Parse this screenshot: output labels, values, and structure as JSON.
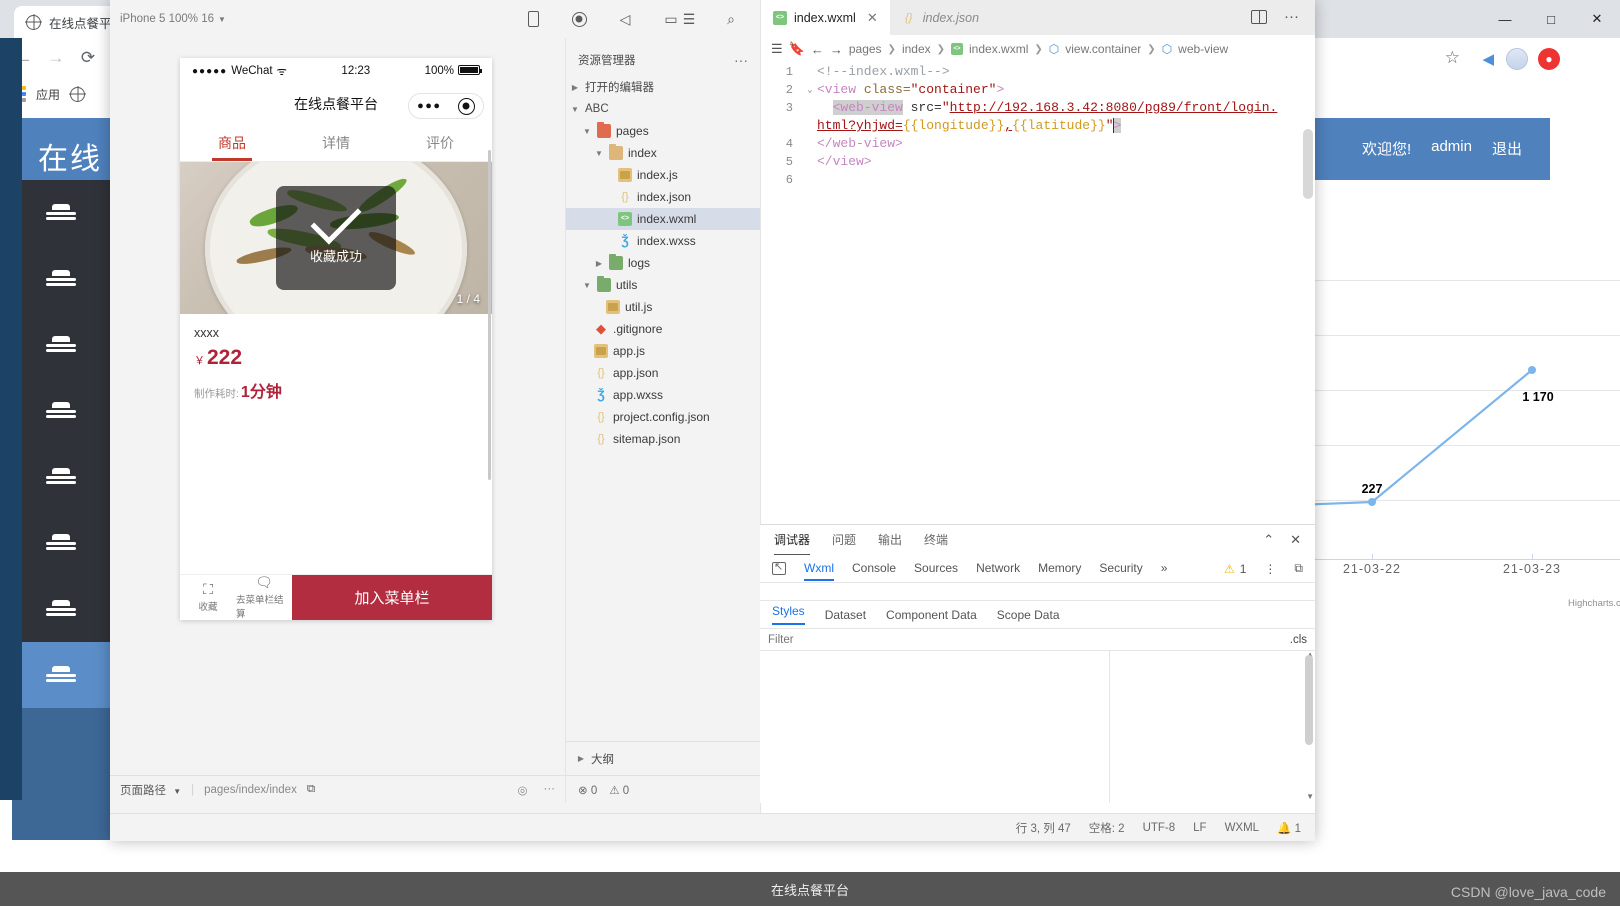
{
  "browser": {
    "tab_title": "在线点餐平",
    "bookmark_apps": "应用",
    "window_buttons": {
      "minimize": "—",
      "maximize": "□",
      "close": "✕"
    }
  },
  "webapp": {
    "title": "在线",
    "welcome": "欢迎您!",
    "username": "admin",
    "logout": "退出",
    "accent": "#4f81bd",
    "sidebar_dark": "#2f3238",
    "sidebar_items": [
      {
        "name": "menu-icon"
      },
      {
        "name": "menu-icon"
      },
      {
        "name": "menu-icon"
      },
      {
        "name": "menu-icon"
      },
      {
        "name": "menu-icon"
      },
      {
        "name": "menu-icon"
      },
      {
        "name": "menu-icon"
      },
      {
        "name": "menu-icon"
      }
    ]
  },
  "chart_data": {
    "type": "line",
    "title": "",
    "subtitle": "",
    "xlabel": "",
    "ylabel": "",
    "categories": [
      "21-03-22",
      "21-03-23"
    ],
    "series": [
      {
        "name": "",
        "values": [
          227,
          1170
        ],
        "color": "#7cb5ec"
      }
    ],
    "data_labels": [
      "227",
      "1 170"
    ],
    "ylim": [
      0,
      1400
    ],
    "grid": true,
    "legend": "none",
    "credit": "Highcharts.com"
  },
  "devtools": {
    "simulator": {
      "device_label": "iPhone 5 100% 16",
      "toolbar_icons": [
        "phone-icon",
        "record-icon",
        "clipboard-icon",
        "window-icon",
        "list-icon",
        "search-icon",
        "more-icon",
        "layout-icon"
      ],
      "phone": {
        "carrier": "WeChat",
        "time": "12:23",
        "battery": "100%",
        "nav_title": "在线点餐平台",
        "tabs": [
          {
            "label": "商品",
            "active": true
          },
          {
            "label": "详情",
            "active": false
          },
          {
            "label": "评价",
            "active": false
          }
        ],
        "toast_text": "收藏成功",
        "photo_count": "1 / 4",
        "goods_name": "xxxx",
        "price_symbol": "￥",
        "price_value": "222",
        "time_label": "制作耗时:",
        "time_value": "1分钟",
        "bottom_actions": [
          {
            "icon": "favorite-icon",
            "label": "收藏"
          },
          {
            "icon": "cart-icon",
            "label": "去菜单栏结算"
          }
        ],
        "cta_label": "加入菜单栏"
      },
      "footer": {
        "page_path_label": "页面路径",
        "page_path_value": "pages/index/index",
        "copy_icon": "copy-icon",
        "eye_icon": "eye-icon",
        "more_icon": "more-icon"
      }
    },
    "explorer": {
      "title": "资源管理器",
      "more": "···",
      "open_editors": "打开的编辑器",
      "project": "ABC",
      "tree": [
        {
          "label": "pages",
          "type": "folder-red",
          "depth": 1,
          "expanded": true
        },
        {
          "label": "index",
          "type": "folder",
          "depth": 2,
          "expanded": true
        },
        {
          "label": "index.js",
          "type": "js",
          "depth": 3
        },
        {
          "label": "index.json",
          "type": "json",
          "depth": 3
        },
        {
          "label": "index.wxml",
          "type": "wxml",
          "depth": 3,
          "selected": true
        },
        {
          "label": "index.wxss",
          "type": "wxss",
          "depth": 3
        },
        {
          "label": "logs",
          "type": "folder-green",
          "depth": 2,
          "expanded": false
        },
        {
          "label": "utils",
          "type": "folder-green",
          "depth": 1,
          "expanded": true
        },
        {
          "label": "util.js",
          "type": "js",
          "depth": 2
        },
        {
          "label": ".gitignore",
          "type": "git",
          "depth": 1
        },
        {
          "label": "app.js",
          "type": "js",
          "depth": 1
        },
        {
          "label": "app.json",
          "type": "json",
          "depth": 1
        },
        {
          "label": "app.wxss",
          "type": "wxss",
          "depth": 1
        },
        {
          "label": "project.config.json",
          "type": "json",
          "depth": 1
        },
        {
          "label": "sitemap.json",
          "type": "json",
          "depth": 1
        }
      ],
      "outline": "大纲",
      "errors": "0",
      "warnings": "0"
    },
    "editor": {
      "tabs": [
        {
          "label": "index.wxml",
          "active": true,
          "icon": "wxml-icon",
          "close": "✕"
        },
        {
          "label": "index.json",
          "active": false,
          "icon": "json-icon"
        }
      ],
      "breadcrumb": [
        "pages",
        "index",
        "index.wxml",
        "view.container",
        "web-view"
      ],
      "lines": [
        {
          "n": "1",
          "fold": ""
        },
        {
          "n": "2",
          "fold": "⌄"
        },
        {
          "n": "3",
          "fold": ""
        },
        {
          "n": "4",
          "fold": ""
        },
        {
          "n": "5",
          "fold": ""
        },
        {
          "n": "6",
          "fold": ""
        }
      ],
      "code": {
        "l1_comment": "<!--index.wxml-->",
        "l2_a": "<view",
        "l2_b": " class=",
        "l2_c": "\"container\"",
        "l2_d": ">",
        "l3_tag": "<web-view",
        "l3_attr": " src=",
        "l3_q1": "\"",
        "l3_url": "http://192.168.3.42:8080/pg89/front/login.",
        "l3b_url": "html?yhjwd=",
        "l3b_b1": "{{longitude}}",
        "l3b_comma": ",",
        "l3b_b2": "{{latitude}}",
        "l3b_q2": "\"",
        "l3b_gt": ">",
        "l4": "</web-view>",
        "l5": "</view>"
      }
    },
    "debugger": {
      "panel_tabs": [
        {
          "label": "调试器",
          "active": true
        },
        {
          "label": "问题",
          "active": false
        },
        {
          "label": "输出",
          "active": false
        },
        {
          "label": "终端",
          "active": false
        }
      ],
      "collapse_icon": "chevron-up-icon",
      "close_icon": "close-icon",
      "devtool_tabs": [
        {
          "label": "Wxml",
          "active": true
        },
        {
          "label": "Console",
          "active": false
        },
        {
          "label": "Sources",
          "active": false
        },
        {
          "label": "Network",
          "active": false
        },
        {
          "label": "Memory",
          "active": false
        },
        {
          "label": "Security",
          "active": false
        },
        {
          "label": "»",
          "active": false
        }
      ],
      "warning_count": "1",
      "kebab_icon": "more-vertical-icon",
      "dock_icon": "dock-icon",
      "style_tabs": [
        {
          "label": "Styles",
          "active": true
        },
        {
          "label": "Dataset",
          "active": false
        },
        {
          "label": "Component Data",
          "active": false
        },
        {
          "label": "Scope Data",
          "active": false
        }
      ],
      "filter_placeholder": "Filter",
      "cls_label": ".cls"
    },
    "status_bar": {
      "position": "行 3, 列 47",
      "spaces": "空格: 2",
      "encoding": "UTF-8",
      "eol": "LF",
      "language": "WXML",
      "bell_icon": "bell-icon",
      "bell_count": "1"
    }
  },
  "taskbar": {
    "label": "在线点餐平台"
  },
  "watermark": "CSDN @love_java_code"
}
